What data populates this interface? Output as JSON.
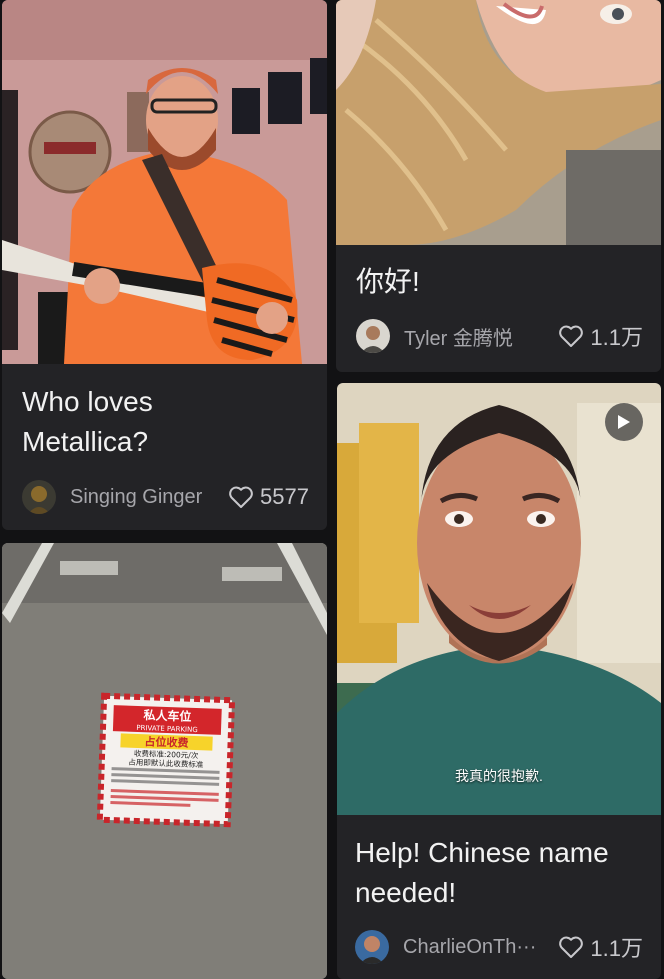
{
  "feed": {
    "posts": [
      {
        "caption_line1": "Who loves",
        "caption_line2": "Metallica?",
        "author": "Singing Ginger",
        "likes": "5577",
        "thumbnail": "man-playing-guitar"
      },
      {
        "caption": "你好!",
        "author": "Tyler 金腾悦",
        "likes": "1.1万",
        "thumbnail": "woman-close-up"
      },
      {
        "thumbnail": "parking-space-sign",
        "sign": {
          "title": "私人车位",
          "subtitle": "PRIVATE PARKING",
          "highlight": "占位收费",
          "rate_line1": "收费标准:200元/次",
          "rate_line2": "占用即默认此收费标准"
        }
      },
      {
        "caption_line1": "Help! Chinese name",
        "caption_line2": "needed!",
        "author": "CharlieOnTh···",
        "likes": "1.1万",
        "thumbnail": "man-talking-to-camera",
        "video_subtitle": "我真的很抱歉.",
        "has_play_icon": true
      }
    ]
  },
  "colors": {
    "background": "#121214",
    "card": "#232326",
    "text": "#f2f2f2",
    "muted": "#a6a6ab"
  },
  "icons": [
    "heart-icon",
    "play-icon"
  ]
}
